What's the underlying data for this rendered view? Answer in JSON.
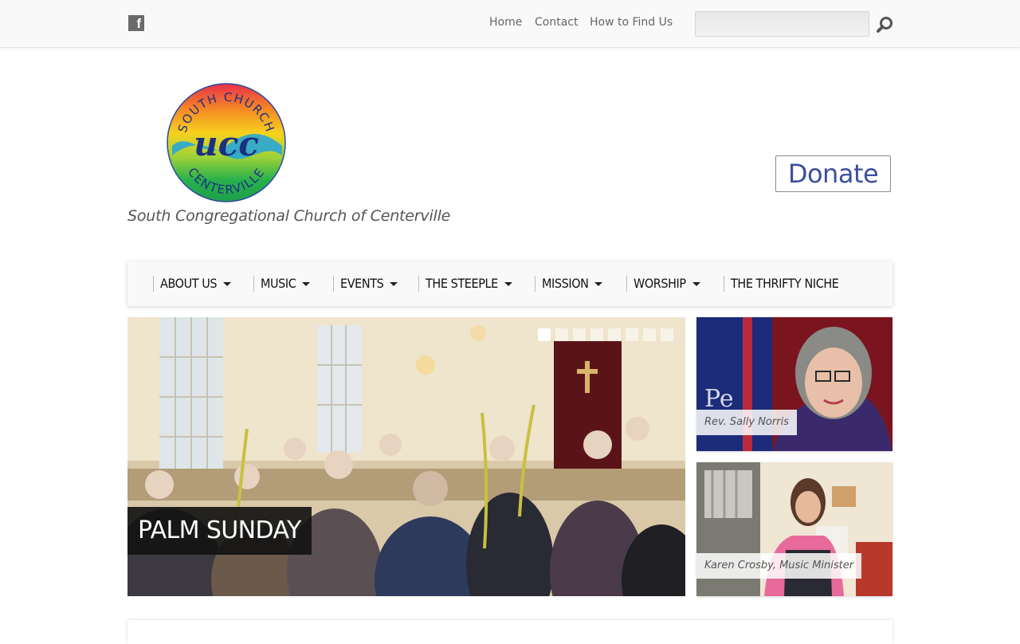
{
  "topbar": {
    "social": {
      "icon": "facebook-icon",
      "glyph": "f"
    },
    "nav": [
      {
        "label": "Home"
      },
      {
        "label": "Contact"
      },
      {
        "label": "How to Find Us"
      }
    ],
    "search": {
      "value": "",
      "icon": "search-icon"
    }
  },
  "header": {
    "logo": {
      "top_text": "SOUTH CHURCH",
      "middle_text": "ucc",
      "bottom_text": "CENTERVILLE"
    },
    "tagline": "South Congregational Church of Centerville",
    "donate_label": "Donate"
  },
  "main_nav": [
    {
      "label": "ABOUT US",
      "has_dropdown": true
    },
    {
      "label": "MUSIC",
      "has_dropdown": true
    },
    {
      "label": "EVENTS",
      "has_dropdown": true
    },
    {
      "label": "THE STEEPLE",
      "has_dropdown": true
    },
    {
      "label": "MISSION",
      "has_dropdown": true
    },
    {
      "label": "WORSHIP",
      "has_dropdown": true
    },
    {
      "label": "THE THRIFTY NICHE",
      "has_dropdown": false
    }
  ],
  "slider": {
    "caption": "PALM SUNDAY",
    "slide_count": 8,
    "active_slide": 1
  },
  "side_features": [
    {
      "caption": "Rev. Sally Norris"
    },
    {
      "caption": "Karen Crosby, Music Minister"
    }
  ],
  "colors": {
    "donate_text": "#3d4f9c",
    "nav_bg": "#f9f9f9",
    "caption_bg": "#141414"
  }
}
